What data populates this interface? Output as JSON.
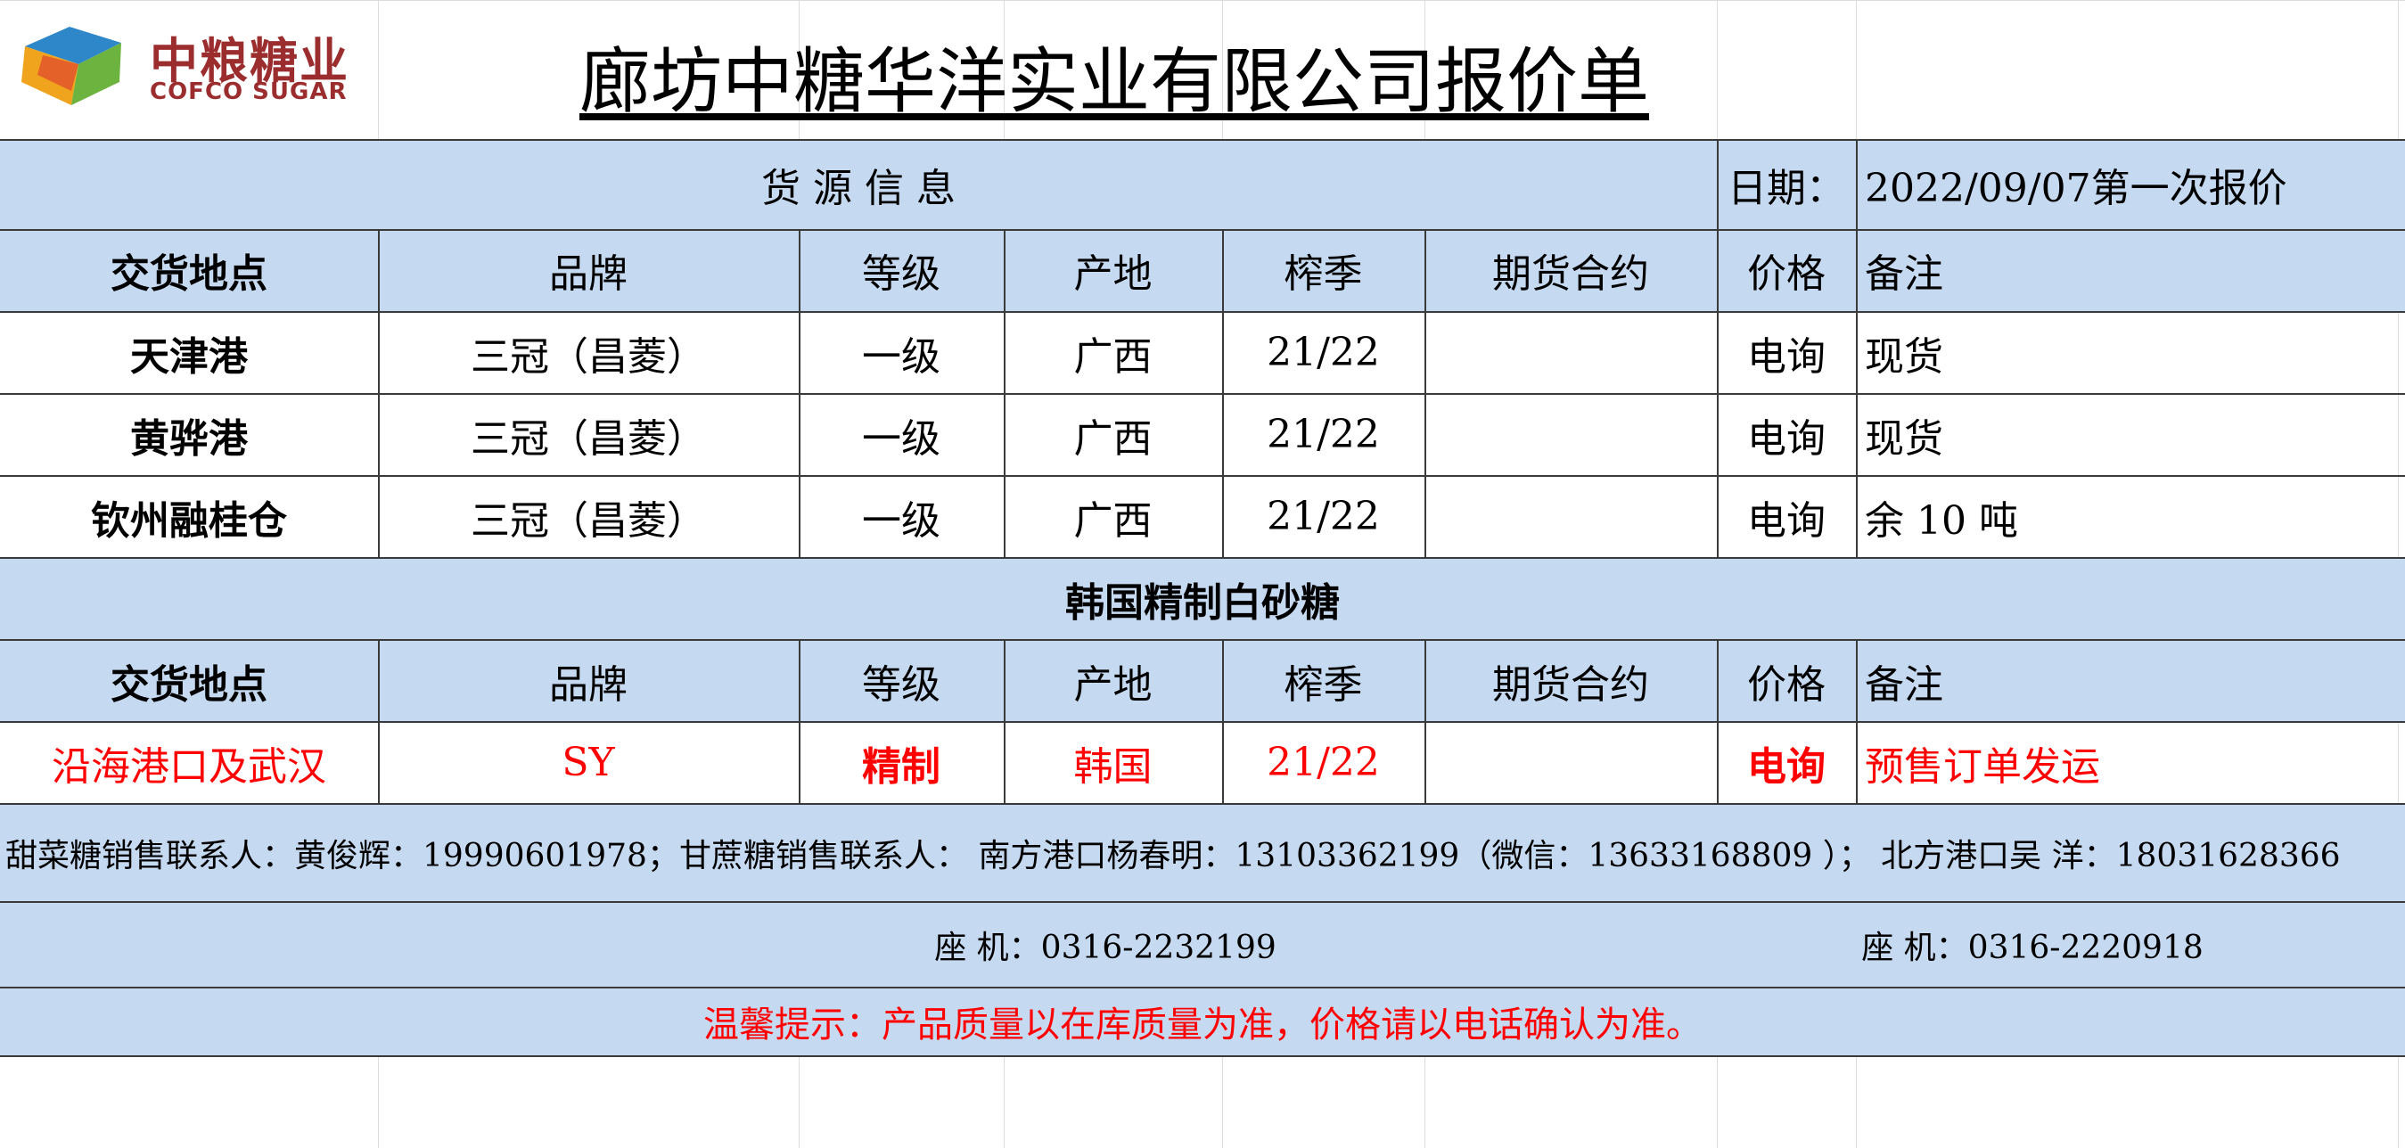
{
  "company": {
    "logo_cn": "中粮糖业",
    "logo_en": "COFCO SUGAR"
  },
  "title": "廊坊中糖华洋实业有限公司报价单",
  "source_info": {
    "label": "货    源    信    息",
    "date_label": "日期：",
    "date_value": "2022/09/07第一次报价"
  },
  "headers": [
    "交货地点",
    "品牌",
    "等级",
    "产地",
    "榨季",
    "期货合约",
    "价格",
    "备注"
  ],
  "rows": [
    [
      "天津港",
      "三冠（昌菱）",
      "一级",
      "广西",
      "21/22",
      "",
      "电询",
      "现货"
    ],
    [
      "黄骅港",
      "三冠（昌菱）",
      "一级",
      "广西",
      "21/22",
      "",
      "电询",
      "现货"
    ],
    [
      "钦州融桂仓",
      "三冠（昌菱）",
      "一级",
      "广西",
      "21/22",
      "",
      "电询",
      "余 10 吨"
    ]
  ],
  "section2": {
    "title": "韩国精制白砂糖",
    "headers": [
      "交货地点",
      "品牌",
      "等级",
      "产地",
      "榨季",
      "期货合约",
      "价格",
      "备注"
    ],
    "row": [
      "沿海港口及武汉",
      "SY",
      "精制",
      "韩国",
      "21/22",
      "",
      "电询",
      "预售订单发运"
    ]
  },
  "contacts": "甜菜糖销售联系人：黄俊辉：19990601978；甘蔗糖销售联系人：  南方港口杨春明：13103362199（微信：13633168809 ）；  北方港口吴  洋：18031628366",
  "phones": [
    "座  机：0316-2232199",
    "座  机：0316-2220918"
  ],
  "notice": "温馨提示：产品质量以在库质量为准，价格请以电话确认为准。",
  "colors": {
    "header_fill": "#c5d9f1",
    "highlight": "#ff0000",
    "logo": "#9b2d2e"
  }
}
